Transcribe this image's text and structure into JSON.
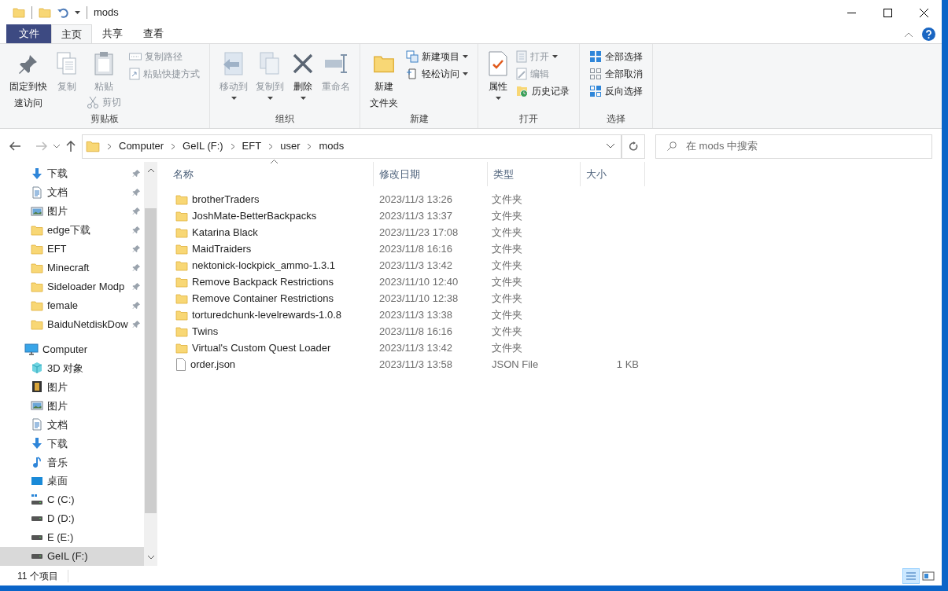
{
  "window": {
    "title": "mods"
  },
  "menu_tabs": [
    {
      "label": "文件",
      "kind": "file",
      "selected": false
    },
    {
      "label": "主页",
      "kind": "tab",
      "selected": true
    },
    {
      "label": "共享",
      "kind": "tab",
      "selected": false
    },
    {
      "label": "查看",
      "kind": "tab",
      "selected": false
    }
  ],
  "ribbon": [
    {
      "label": "剪贴板",
      "columns": [
        [
          {
            "kind": "large",
            "lines": [
              "固定到快",
              "速访问"
            ],
            "disabled": false,
            "dropdown": false
          }
        ],
        [
          {
            "kind": "large",
            "lines": [
              "复制"
            ],
            "disabled": true,
            "dropdown": false
          }
        ],
        [
          {
            "kind": "large",
            "lines": [
              "粘贴"
            ],
            "disabled": true,
            "dropdown": false
          },
          {
            "kind": "small",
            "lines": [
              "剪切"
            ],
            "disabled": true,
            "dropdown": false
          }
        ],
        [
          {
            "kind": "small",
            "lines": [
              "复制路径"
            ],
            "disabled": true,
            "dropdown": false
          },
          {
            "kind": "small",
            "lines": [
              "粘贴快捷方式"
            ],
            "disabled": true,
            "dropdown": false
          }
        ]
      ]
    },
    {
      "label": "组织",
      "columns": [
        [
          {
            "kind": "large",
            "lines": [
              "移动到"
            ],
            "disabled": true,
            "dropdown": true
          }
        ],
        [
          {
            "kind": "large",
            "lines": [
              "复制到"
            ],
            "disabled": true,
            "dropdown": true
          }
        ],
        [
          {
            "kind": "large",
            "lines": [
              "删除"
            ],
            "disabled": false,
            "dropdown": true
          }
        ],
        [
          {
            "kind": "large",
            "lines": [
              "重命名"
            ],
            "disabled": true,
            "dropdown": false
          }
        ]
      ]
    },
    {
      "label": "新建",
      "columns": [
        [
          {
            "kind": "large",
            "lines": [
              "新建",
              "文件夹"
            ],
            "disabled": false,
            "dropdown": false
          }
        ],
        [
          {
            "kind": "small",
            "lines": [
              "新建项目"
            ],
            "disabled": false,
            "dropdown": true
          },
          {
            "kind": "small",
            "lines": [
              "轻松访问"
            ],
            "disabled": false,
            "dropdown": true
          }
        ]
      ]
    },
    {
      "label": "打开",
      "columns": [
        [
          {
            "kind": "large",
            "lines": [
              "属性"
            ],
            "disabled": false,
            "dropdown": true
          }
        ],
        [
          {
            "kind": "small",
            "lines": [
              "打开"
            ],
            "disabled": true,
            "dropdown": true
          },
          {
            "kind": "small",
            "lines": [
              "编辑"
            ],
            "disabled": true,
            "dropdown": false
          },
          {
            "kind": "small",
            "lines": [
              "历史记录"
            ],
            "disabled": false,
            "dropdown": false
          }
        ]
      ]
    },
    {
      "label": "选择",
      "columns": [
        [
          {
            "kind": "small",
            "lines": [
              "全部选择"
            ],
            "disabled": false,
            "dropdown": false
          },
          {
            "kind": "small",
            "lines": [
              "全部取消"
            ],
            "disabled": false,
            "dropdown": false
          },
          {
            "kind": "small",
            "lines": [
              "反向选择"
            ],
            "disabled": false,
            "dropdown": false
          }
        ]
      ]
    }
  ],
  "address": {
    "path": [
      "Computer",
      "GeIL (F:)",
      "EFT",
      "user",
      "mods"
    ]
  },
  "search": {
    "placeholder": "在 mods 中搜索"
  },
  "navigation": [
    {
      "label": "下载",
      "kind": "download",
      "pinned": true,
      "selected": false
    },
    {
      "label": "文档",
      "kind": "documents",
      "pinned": true,
      "selected": false
    },
    {
      "label": "图片",
      "kind": "pictures",
      "pinned": true,
      "selected": false
    },
    {
      "label": "edge下载",
      "kind": "folder",
      "pinned": true,
      "selected": false
    },
    {
      "label": "EFT",
      "kind": "folder",
      "pinned": true,
      "selected": false
    },
    {
      "label": "Minecraft",
      "kind": "folder",
      "pinned": true,
      "selected": false
    },
    {
      "label": "Sideloader Modp",
      "kind": "folder",
      "pinned": true,
      "selected": false
    },
    {
      "label": "female",
      "kind": "folder",
      "pinned": true,
      "selected": false
    },
    {
      "label": "BaiduNetdiskDow",
      "kind": "folder",
      "pinned": true,
      "selected": false
    },
    {
      "label": "Computer",
      "kind": "computer",
      "pinned": false,
      "selected": false,
      "children": [
        {
          "label": "3D 对象",
          "kind": "objects3d",
          "pinned": false,
          "selected": false
        },
        {
          "label": "图片",
          "kind": "videos",
          "pinned": false,
          "selected": false
        },
        {
          "label": "图片",
          "kind": "pictures",
          "pinned": false,
          "selected": false
        },
        {
          "label": "文档",
          "kind": "documents",
          "pinned": false,
          "selected": false
        },
        {
          "label": "下载",
          "kind": "download",
          "pinned": false,
          "selected": false
        },
        {
          "label": "音乐",
          "kind": "music",
          "pinned": false,
          "selected": false
        },
        {
          "label": "桌面",
          "kind": "desktop",
          "pinned": false,
          "selected": false
        },
        {
          "label": "C (C:)",
          "kind": "system_drive",
          "pinned": false,
          "selected": false
        },
        {
          "label": "D (D:)",
          "kind": "drive",
          "pinned": false,
          "selected": false
        },
        {
          "label": "E (E:)",
          "kind": "drive",
          "pinned": false,
          "selected": false
        },
        {
          "label": "GeIL (F:)",
          "kind": "drive",
          "pinned": false,
          "selected": true
        }
      ]
    }
  ],
  "table": {
    "columns": [
      {
        "label": "名称",
        "sorted": true
      },
      {
        "label": "修改日期",
        "sorted": false
      },
      {
        "label": "类型",
        "sorted": false
      },
      {
        "label": "大小",
        "sorted": false
      }
    ],
    "rows": [
      {
        "kind": "folder",
        "name": "brotherTraders",
        "date": "2023/11/3 13:26",
        "type": "文件夹"
      },
      {
        "kind": "folder",
        "name": "JoshMate-BetterBackpacks",
        "date": "2023/11/3 13:37",
        "type": "文件夹"
      },
      {
        "kind": "folder",
        "name": "Katarina Black",
        "date": "2023/11/23 17:08",
        "type": "文件夹"
      },
      {
        "kind": "folder",
        "name": "MaidTraiders",
        "date": "2023/11/8 16:16",
        "type": "文件夹"
      },
      {
        "kind": "folder",
        "name": "nektonick-lockpick_ammo-1.3.1",
        "date": "2023/11/3 13:42",
        "type": "文件夹"
      },
      {
        "kind": "folder",
        "name": "Remove Backpack Restrictions",
        "date": "2023/11/10 12:40",
        "type": "文件夹"
      },
      {
        "kind": "folder",
        "name": "Remove Container Restrictions",
        "date": "2023/11/10 12:38",
        "type": "文件夹"
      },
      {
        "kind": "folder",
        "name": "torturedchunk-levelrewards-1.0.8",
        "date": "2023/11/3 13:38",
        "type": "文件夹"
      },
      {
        "kind": "folder",
        "name": "Twins",
        "date": "2023/11/8 16:16",
        "type": "文件夹"
      },
      {
        "kind": "folder",
        "name": "Virtual's Custom Quest Loader",
        "date": "2023/11/3 13:42",
        "type": "文件夹"
      },
      {
        "kind": "file",
        "name": "order.json",
        "date": "2023/11/3 13:58",
        "type": "JSON File",
        "size": "1 KB"
      }
    ]
  },
  "status_bar": {
    "count": "11 个项目"
  }
}
